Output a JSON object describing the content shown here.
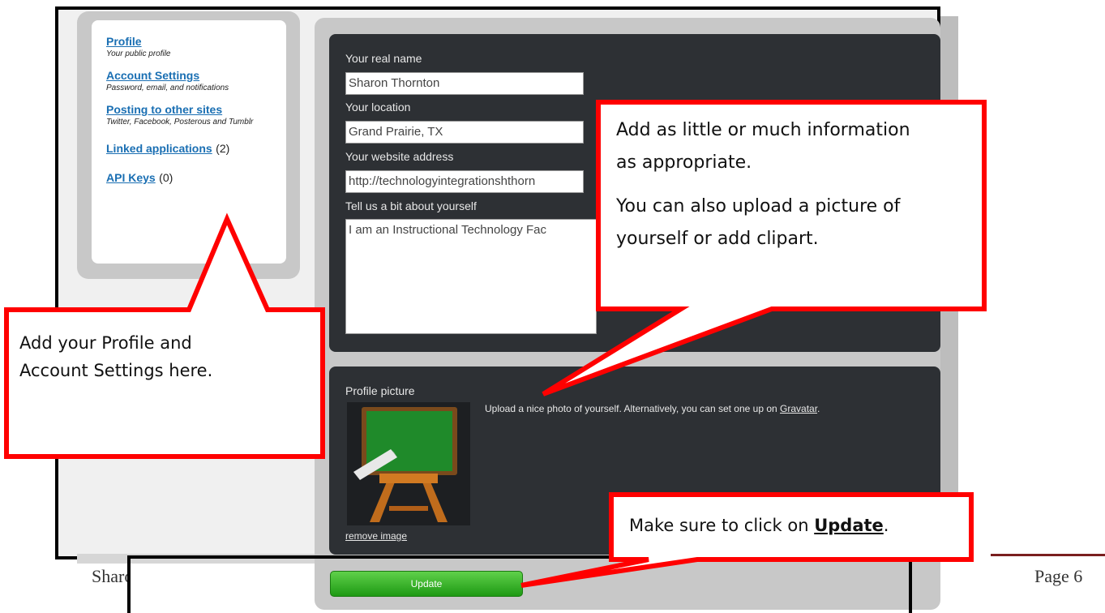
{
  "sidebar": {
    "items": [
      {
        "label": "Profile",
        "sub": "Your public profile",
        "count": ""
      },
      {
        "label": "Account Settings",
        "sub": "Password, email, and notifications",
        "count": ""
      },
      {
        "label": "Posting to other sites",
        "sub": "Twitter, Facebook, Posterous and Tumblr",
        "count": ""
      },
      {
        "label": "Linked applications",
        "sub": "",
        "count": "(2)"
      },
      {
        "label": "API Keys",
        "sub": "",
        "count": "(0)"
      }
    ]
  },
  "form": {
    "real_name_label": "Your real name",
    "real_name_value": "Sharon Thornton",
    "location_label": "Your location",
    "location_value": "Grand Prairie, TX",
    "website_label": "Your website address",
    "website_value": "http://technologyintegrationshthorn",
    "bio_label": "Tell us a bit about yourself",
    "bio_value": "I am an Instructional Technology Fac"
  },
  "picture": {
    "label": "Profile picture",
    "upload_text": "Upload a nice photo of yourself. Alternatively, you can set one up on ",
    "gravatar_link": "Gravatar",
    "upload_suffix": ".",
    "remove_link": "remove image"
  },
  "update_button": "Update",
  "footer": {
    "left_text": "Sharon Thornton",
    "page": "Page 6"
  },
  "callouts": {
    "profile": {
      "line1": "Add your Profile and",
      "line2": "Account Settings here."
    },
    "info": {
      "line1": "Add as little or much information",
      "line2": "as appropriate.",
      "line3": "You can also upload a picture of",
      "line4": "yourself or add clipart."
    },
    "update": {
      "prefix": "Make sure to click on ",
      "emphasis": "Update",
      "suffix": "."
    }
  },
  "colors": {
    "callout_border": "#ff0000",
    "panel_bg": "#2d3034",
    "link_blue": "#1a6fb3",
    "button_green": "#2fae22"
  }
}
